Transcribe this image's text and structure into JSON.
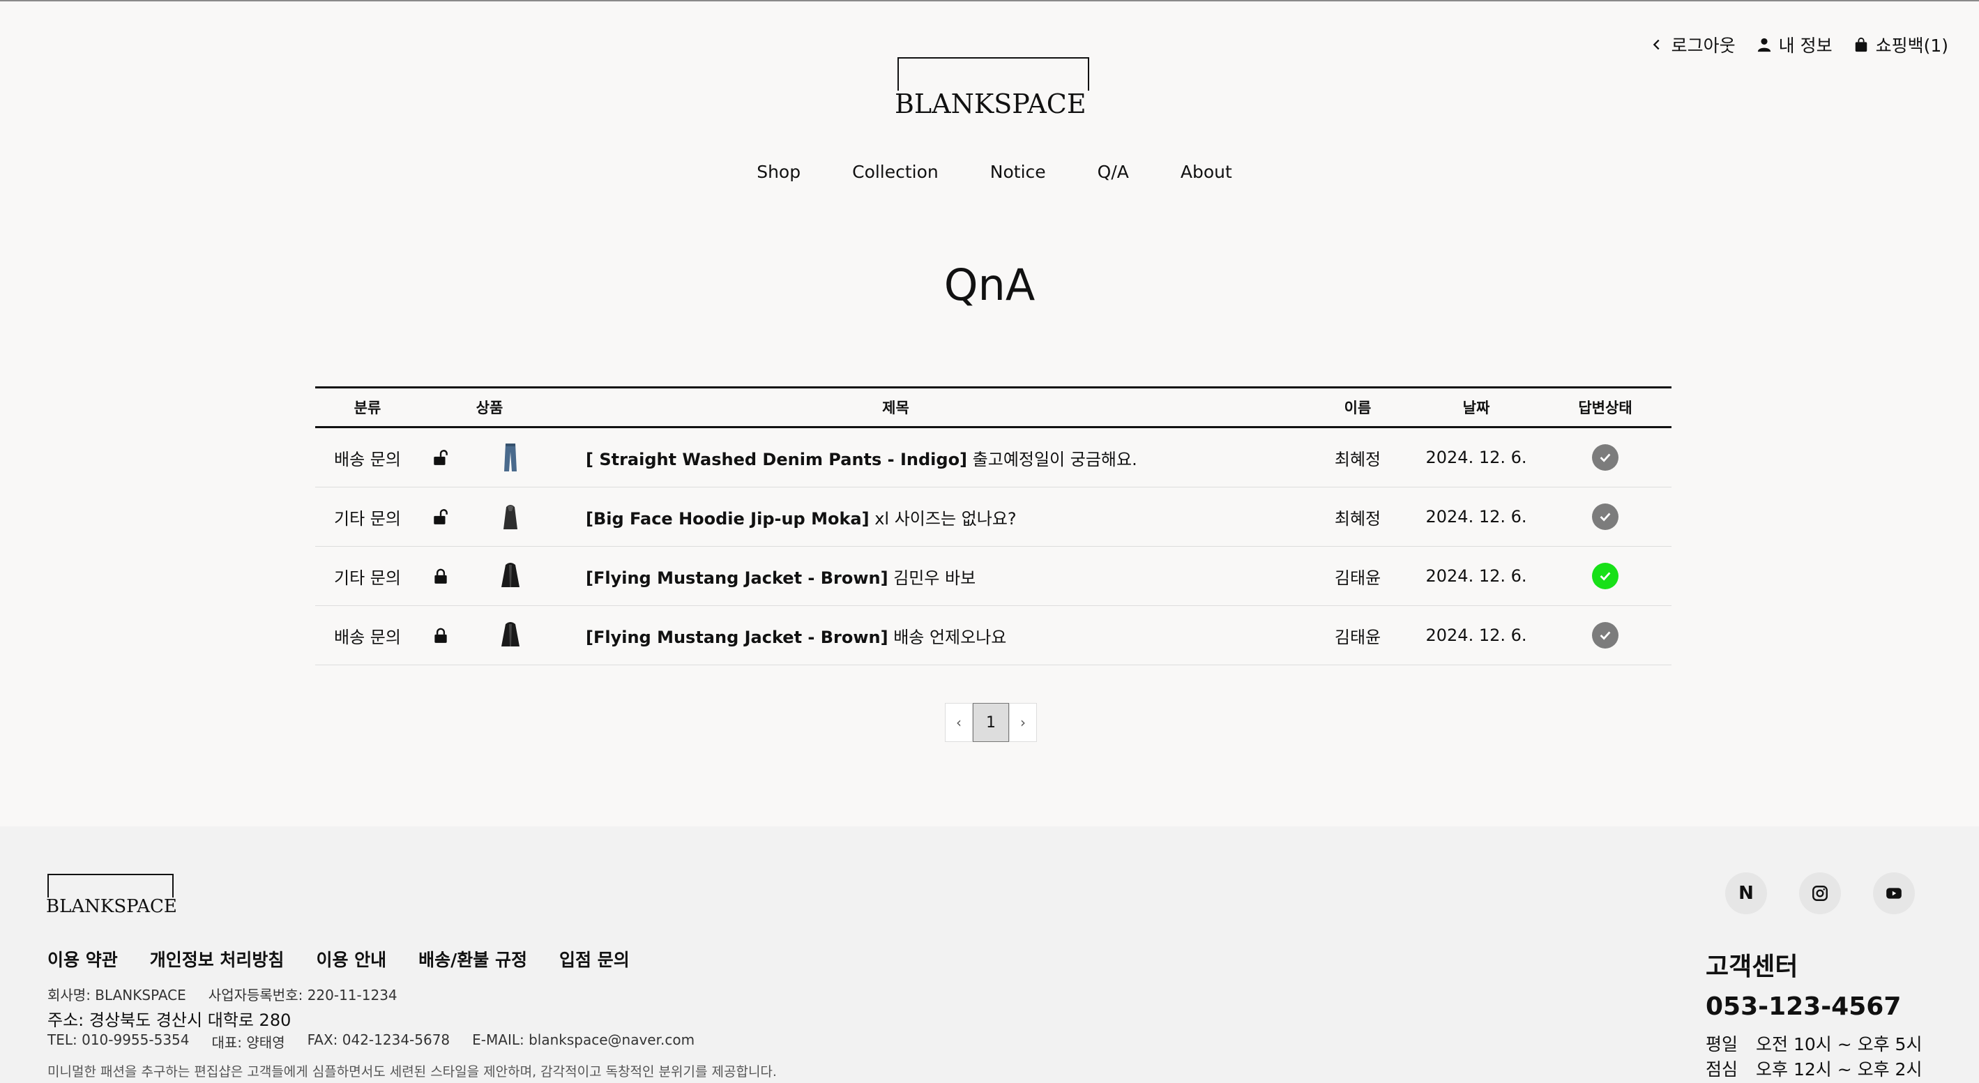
{
  "header": {
    "util": {
      "logout": "로그아웃",
      "my_info": "내 정보",
      "cart": "쇼핑백(1)"
    },
    "logo": "BLANKSPACE",
    "nav": [
      "Shop",
      "Collection",
      "Notice",
      "Q/A",
      "About"
    ]
  },
  "page_title": "QnA",
  "table": {
    "headers": {
      "category": "분류",
      "product": "상품",
      "title": "제목",
      "name": "이름",
      "date": "날짜",
      "status": "답변상태"
    },
    "rows": [
      {
        "category": "배송 문의",
        "locked": false,
        "product_title": "[ Straight Washed Denim Pants - Indigo]",
        "question": " 출고예정일이 궁금해요.",
        "name": "최혜정",
        "date": "2024. 12. 6.",
        "answered": false,
        "thumb": "denim-pants"
      },
      {
        "category": "기타 문의",
        "locked": false,
        "product_title": "[Big Face Hoodie Jip-up Moka]",
        "question": " xl 사이즈는 없나요?",
        "name": "최혜정",
        "date": "2024. 12. 6.",
        "answered": false,
        "thumb": "hoodie"
      },
      {
        "category": "기타 문의",
        "locked": true,
        "product_title": "[Flying Mustang Jacket - Brown]",
        "question": " 김민우 바보",
        "name": "김태윤",
        "date": "2024. 12. 6.",
        "answered": true,
        "thumb": "jacket"
      },
      {
        "category": "배송 문의",
        "locked": true,
        "product_title": "[Flying Mustang Jacket - Brown]",
        "question": " 배송 언제오나요",
        "name": "김태윤",
        "date": "2024. 12. 6.",
        "answered": false,
        "thumb": "jacket"
      }
    ]
  },
  "pagination": {
    "prev": "‹",
    "current": "1",
    "next": "›"
  },
  "footer": {
    "logo": "BLANKSPACE",
    "links": [
      "이용 약관",
      "개인정보 처리방침",
      "이용 안내",
      "배송/환불 규정",
      "입점 문의"
    ],
    "company": "회사명: BLANKSPACE",
    "biz_no": "사업자등록번호: 220-11-1234",
    "address": "주소: 경상북도 경산시 대학로 280",
    "tel": "TEL: 010-9955-5354",
    "ceo": "대표: 양태영",
    "fax": "FAX: 042-1234-5678",
    "email": "E-MAIL: blankspace@naver.com",
    "description": "미니멀한 패션을 추구하는 편집샵은 고객들에게 심플하면서도 세련된 스타일을 제안하며, 감각적이고 독창적인 분위기를 제공합니다.",
    "social": {
      "naver": "N"
    },
    "cs": {
      "title": "고객센터",
      "phone": "053-123-4567",
      "weekday_label": "평일",
      "weekday_hours": "오전 10시 ~ 오후 5시",
      "lunch_label": "점심",
      "lunch_hours": "오후 12시 ~ 오후 2시"
    }
  },
  "colors": {
    "answered": "#18e018",
    "pending": "#7c7c7c",
    "background": "#f9f8f7",
    "footer_bg": "#f2f2f2"
  }
}
